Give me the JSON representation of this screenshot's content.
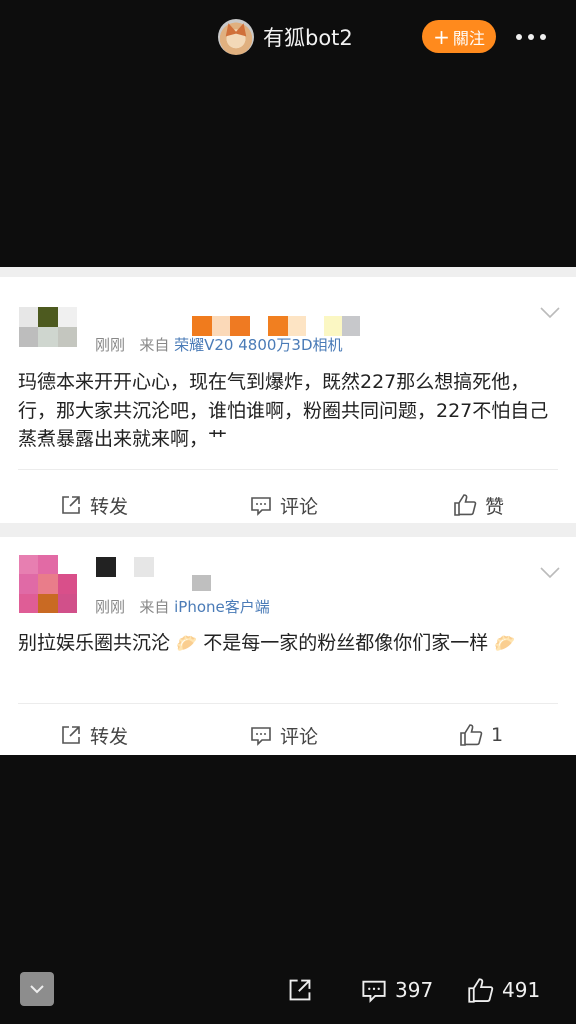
{
  "header": {
    "username": "有狐bot2",
    "follow_label": "關注",
    "avatar_icon": "fox-avatar-icon",
    "more_icon": "more-dots-icon"
  },
  "comments": [
    {
      "time": "刚刚",
      "from_prefix": "来自",
      "source": "荣耀V20 4800万3D相机",
      "text": "玛德本来开开心心，现在气到爆炸，既然227那么想搞死他，行，那大家共沉沦吧，谁怕谁啊，粉圈共同问题，227不怕自己蒸煮暴露出来就来啊，艹",
      "repost_label": "转发",
      "comment_label": "评论",
      "like_label": "赞"
    },
    {
      "time": "刚刚",
      "from_prefix": "来自",
      "source": "iPhone客户端",
      "text": "别拉娱乐圈共沉沦",
      "text_mid": " 不是每一家的粉丝都像你们家一样",
      "emoji": "🥟",
      "repost_label": "转发",
      "comment_label": "评论",
      "like_label": "1"
    }
  ],
  "bottom_bar": {
    "comment_count": "397",
    "like_count": "491"
  },
  "colors": {
    "accent": "#ff8a1d",
    "link": "#4a7bb7",
    "background": "#0d0d0d"
  }
}
